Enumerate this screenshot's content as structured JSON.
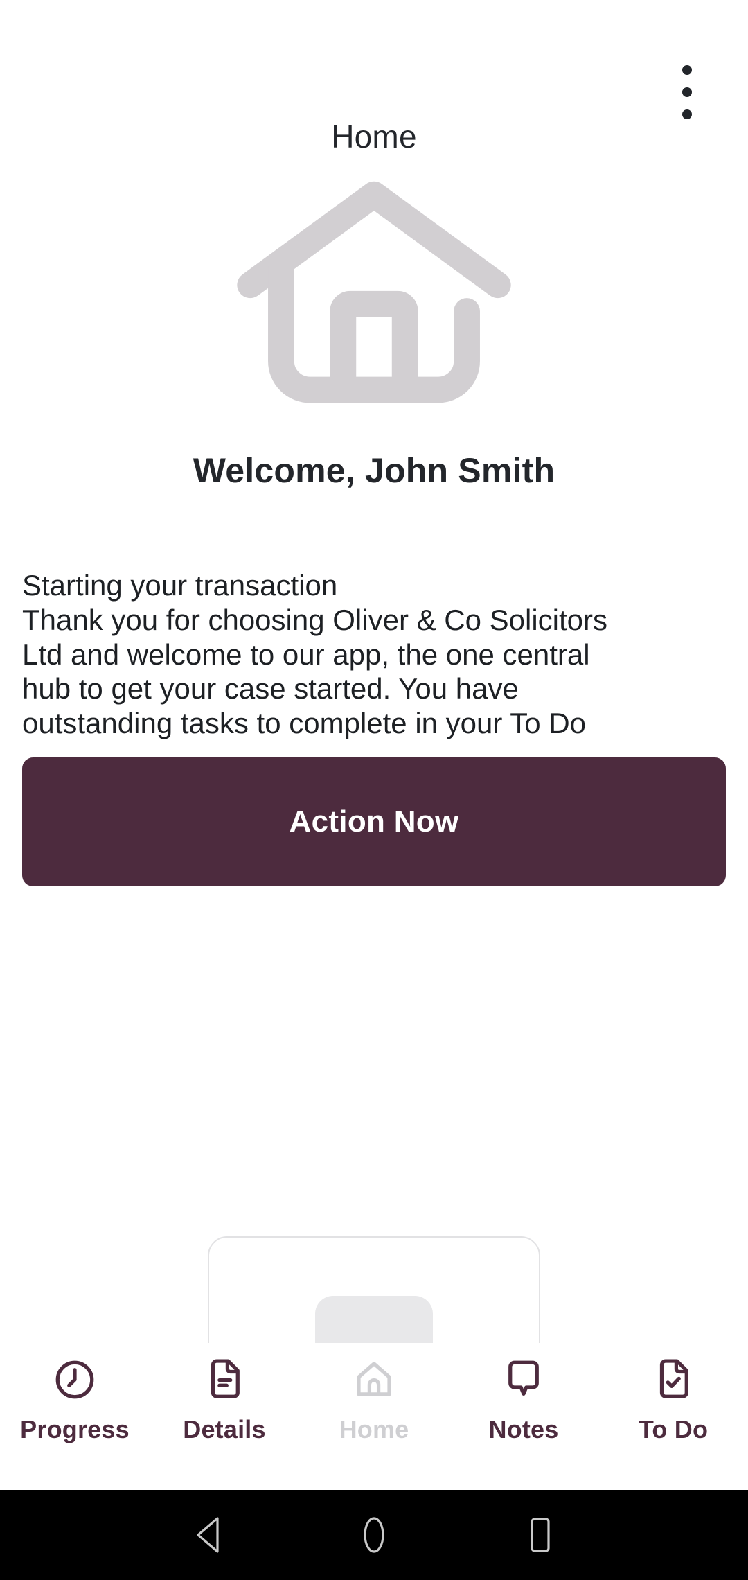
{
  "app": {
    "header": {
      "title": "Home",
      "overflow_menu_icon": "more-vertical-icon"
    }
  },
  "hero": {
    "illustration_icon": "house-outline-icon",
    "illustration_color": "#d2cfd2",
    "welcome_text": "Welcome, John Smith"
  },
  "content": {
    "paragraph_lines": [
      "Starting your transaction",
      "Thank you for choosing Oliver & Co Solicitors",
      "Ltd and welcome to our app, the one central",
      "hub to get your case started. You have",
      "outstanding tasks to complete in your To Do"
    ],
    "full_paragraph": "Starting your transaction Thank you for choosing Oliver & Co Solicitors Ltd and welcome to our app, the one central hub to get your case started. You have outstanding tasks to complete in your To Do"
  },
  "cta": {
    "label": "Action Now",
    "background_color": "#4d2b3e",
    "text_color": "#ffffff"
  },
  "peek_card": {
    "badge_icon": "document-pair-icon",
    "border_color": "#e2e2e4",
    "badge_color": "#e8e8ea"
  },
  "bottom_nav": {
    "accent_color": "#4d2b3e",
    "inactive_color": "#cfcfd2",
    "items": [
      {
        "label": "Progress",
        "icon": "clock-icon",
        "active": false
      },
      {
        "label": "Details",
        "icon": "document-icon",
        "active": false
      },
      {
        "label": "Home",
        "icon": "home-icon",
        "active": true
      },
      {
        "label": "Notes",
        "icon": "speech-bubble-icon",
        "active": false
      },
      {
        "label": "To Do",
        "icon": "document-check-icon",
        "active": false
      }
    ]
  },
  "system_nav": {
    "background_color": "#000000",
    "buttons": [
      {
        "name": "back",
        "icon": "triangle-back-icon"
      },
      {
        "name": "home",
        "icon": "circle-home-icon"
      },
      {
        "name": "recents",
        "icon": "square-recents-icon"
      }
    ]
  }
}
